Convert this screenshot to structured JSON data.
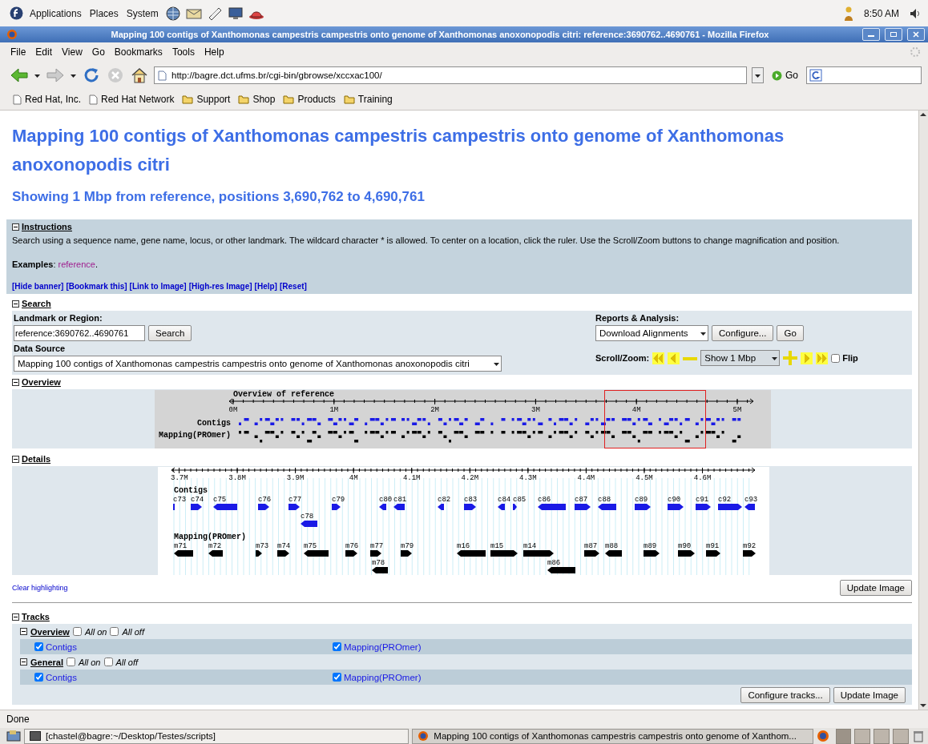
{
  "desktop_panel": {
    "menus": [
      "Applications",
      "Places",
      "System"
    ],
    "clock": "8:50 AM"
  },
  "window": {
    "title": "Mapping 100 contigs of Xanthomonas campestris campestris onto genome of Xanthomonas anoxonopodis citri: reference:3690762..4690761 - Mozilla Firefox"
  },
  "menu_bar": [
    "File",
    "Edit",
    "View",
    "Go",
    "Bookmarks",
    "Tools",
    "Help"
  ],
  "navigation": {
    "url": "http://bagre.dct.ufms.br/cgi-bin/gbrowse/xccxac100/",
    "go_label": "Go"
  },
  "bookmarks": [
    {
      "label": "Red Hat, Inc.",
      "kind": "page"
    },
    {
      "label": "Red Hat Network",
      "kind": "page"
    },
    {
      "label": "Support",
      "kind": "folder"
    },
    {
      "label": "Shop",
      "kind": "folder"
    },
    {
      "label": "Products",
      "kind": "folder"
    },
    {
      "label": "Training",
      "kind": "folder"
    }
  ],
  "page": {
    "title": "Mapping 100 contigs of Xanthomonas campestris campestris onto genome of Xanthomonas anoxonopodis citri",
    "subtitle": "Showing 1 Mbp from reference, positions 3,690,762 to 4,690,761",
    "instructions": {
      "heading": "Instructions",
      "expanded": true,
      "text": "Search using a sequence name, gene name, locus, or other landmark. The wildcard character * is allowed. To center on a location, click the ruler. Use the Scroll/Zoom buttons to change magnification and position.",
      "examples_label": "**Examples**:",
      "examples_link": "reference",
      "examples_suffix": ".",
      "links": [
        "[Hide banner]",
        "[Bookmark this]",
        "[Link to Image]",
        "[High-res Image]",
        "[Help]",
        "[Reset]"
      ]
    },
    "search": {
      "heading": "Search",
      "expanded": true,
      "landmark_label": "Landmark or Region:",
      "landmark_value": "reference:3690762..4690761",
      "search_button": "Search",
      "data_source_label": "Data Source",
      "data_source_value": "Mapping 100 contigs of Xanthomonas campestris campestris onto genome of Xanthomonas anoxonopodis citri",
      "reports_label": "Reports & Analysis:",
      "reports_value": "Download Alignments",
      "configure_button": "Configure...",
      "go_button": "Go",
      "scroll_zoom_label": "Scroll/Zoom:",
      "zoom_value": "Show 1 Mbp",
      "flip": {
        "label": "Flip",
        "checked": false
      }
    },
    "overview": {
      "heading": "Overview",
      "expanded": true,
      "title": "Overview of reference",
      "ticks": [
        "0M",
        "1M",
        "2M",
        "3M",
        "4M",
        "5M"
      ],
      "tracks": [
        {
          "name": "Contigs",
          "kind": "contig"
        },
        {
          "name": "Mapping(PROmer)",
          "kind": "mapping"
        }
      ]
    },
    "details": {
      "heading": "Details",
      "expanded": true,
      "ticks": [
        "3.7M",
        "3.8M",
        "3.9M",
        "4M",
        "4.1M",
        "4.2M",
        "4.3M",
        "4.4M",
        "4.5M",
        "4.6M"
      ],
      "tracks": [
        {
          "name": "Contigs",
          "kind": "contig",
          "features": [
            {
              "label": "c73",
              "kind": "plain"
            },
            {
              "label": "c74",
              "kind": "forward"
            },
            {
              "label": "c75",
              "kind": "reverse"
            },
            {
              "label": "c76",
              "kind": "forward"
            },
            {
              "label": "c77",
              "kind": "forward"
            },
            {
              "label": "c79",
              "kind": "forward"
            },
            {
              "label": "c80",
              "kind": "reverse"
            },
            {
              "label": "c81",
              "kind": "reverse"
            },
            {
              "label": "c82",
              "kind": "reverse"
            },
            {
              "label": "c83",
              "kind": "forward"
            },
            {
              "label": "c84",
              "kind": "reverse"
            },
            {
              "label": "c85",
              "kind": "forward"
            },
            {
              "label": "c86",
              "kind": "reverse"
            },
            {
              "label": "c87",
              "kind": "forward"
            },
            {
              "label": "c88",
              "kind": "reverse"
            },
            {
              "label": "c89",
              "kind": "forward"
            },
            {
              "label": "c90",
              "kind": "forward"
            },
            {
              "label": "c91",
              "kind": "forward"
            },
            {
              "label": "c92",
              "kind": "forward"
            },
            {
              "label": "c93",
              "kind": "reverse"
            },
            {
              "label": "c78",
              "kind": "reverse"
            }
          ]
        },
        {
          "name": "Mapping(PROmer)",
          "kind": "mapping",
          "features": [
            {
              "label": "m71",
              "kind": "reverse"
            },
            {
              "label": "m72",
              "kind": "reverse"
            },
            {
              "label": "m73",
              "kind": "forward"
            },
            {
              "label": "m74",
              "kind": "forward"
            },
            {
              "label": "m75",
              "kind": "reverse"
            },
            {
              "label": "m76",
              "kind": "forward"
            },
            {
              "label": "m77",
              "kind": "forward"
            },
            {
              "label": "m79",
              "kind": "forward"
            },
            {
              "label": "m16",
              "kind": "reverse"
            },
            {
              "label": "m15",
              "kind": "forward"
            },
            {
              "label": "m14",
              "kind": "forward"
            },
            {
              "label": "m87",
              "kind": "forward"
            },
            {
              "label": "m88",
              "kind": "reverse"
            },
            {
              "label": "m89",
              "kind": "forward"
            },
            {
              "label": "m90",
              "kind": "forward"
            },
            {
              "label": "m91",
              "kind": "forward"
            },
            {
              "label": "m92",
              "kind": "forward"
            },
            {
              "label": "m78",
              "kind": "reverse"
            },
            {
              "label": "m86",
              "kind": "reverse"
            }
          ]
        }
      ]
    },
    "clear_highlighting": "Clear highlighting",
    "update_button": "Update Image",
    "tracks": {
      "heading": "Tracks",
      "expanded": true,
      "groups": [
        {
          "name": "Overview",
          "expanded": true,
          "all_on": {
            "label": "All on",
            "checked": false
          },
          "all_off": {
            "label": "All off",
            "checked": false
          },
          "items": [
            {
              "label": "Contigs",
              "checked": true
            },
            {
              "label": "Mapping(PROmer)",
              "checked": true
            }
          ]
        },
        {
          "name": "General",
          "expanded": true,
          "all_on": {
            "label": "All on",
            "checked": false
          },
          "all_off": {
            "label": "All off",
            "checked": false
          },
          "items": [
            {
              "label": "Contigs",
              "checked": true
            },
            {
              "label": "Mapping(PROmer)",
              "checked": true
            }
          ]
        }
      ],
      "configure_button": "Configure tracks...",
      "update_button": "Update Image"
    }
  },
  "status_bar": "Done",
  "taskbar": [
    {
      "label": "[chastel@bagre:~/Desktop/Testes/scripts]",
      "kind": "terminal",
      "selected": false
    },
    {
      "label": "Mapping 100 contigs of Xanthomonas campestris campestris onto genome of Xanthom...",
      "kind": "browser",
      "selected": true
    }
  ]
}
